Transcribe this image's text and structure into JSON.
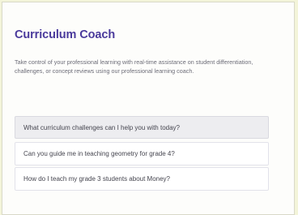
{
  "header": {
    "title": "Curriculum Coach",
    "description": "Take control of your professional learning with real-time assistance on student differentiation, challenges, or concept reviews using our professional learning coach."
  },
  "prompts": [
    {
      "label": "What curriculum challenges can I help you with today?"
    },
    {
      "label": "Can you guide me in teaching geometry for grade 4?"
    },
    {
      "label": "How do I teach my grade 3 students about Money?"
    }
  ]
}
